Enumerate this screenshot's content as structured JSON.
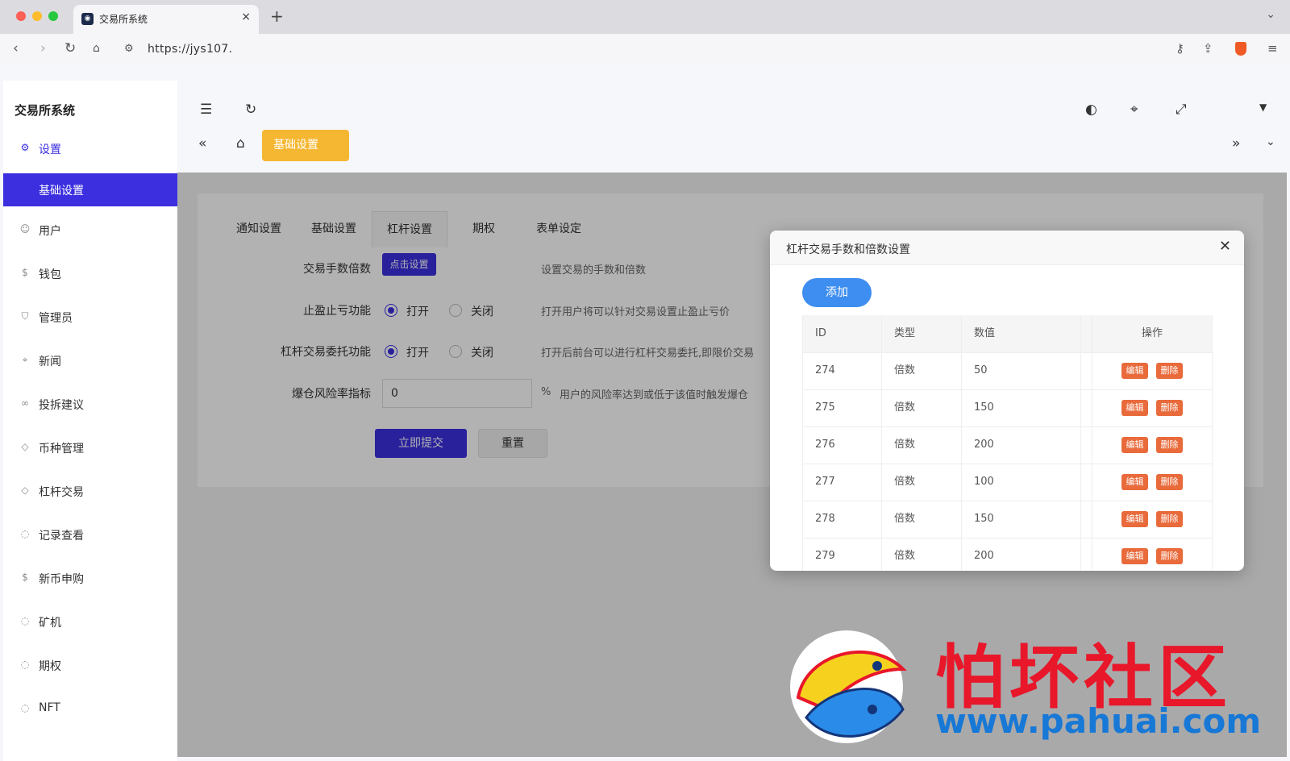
{
  "browser": {
    "tab_title": "交易所系统",
    "tab_close": "×",
    "new_tab": "+",
    "url": "https://jys107.",
    "icons": [
      "back-icon",
      "forward-icon",
      "reload-icon",
      "bookmark-icon",
      "site-settings-icon",
      "key-icon",
      "share-icon",
      "brave-shield-icon",
      "menu-icon"
    ]
  },
  "app": {
    "brand": "交易所系统",
    "page_tag": "基础设置"
  },
  "sidebar": {
    "items": [
      {
        "label": "设置",
        "icon": "gear-icon"
      },
      {
        "label": "基础设置",
        "icon": ""
      },
      {
        "label": "用户",
        "icon": "user-icon"
      },
      {
        "label": "钱包",
        "icon": "coin-icon"
      },
      {
        "label": "管理员",
        "icon": "shield-icon"
      },
      {
        "label": "新闻",
        "icon": "tag-icon"
      },
      {
        "label": "投拆建议",
        "icon": "link-icon"
      },
      {
        "label": "币种管理",
        "icon": "diamond-icon"
      },
      {
        "label": "杠杆交易",
        "icon": "diamond-icon"
      },
      {
        "label": "记录查看",
        "icon": "circle-icon"
      },
      {
        "label": "新币申购",
        "icon": "coin-icon"
      },
      {
        "label": "矿机",
        "icon": "circle-icon"
      },
      {
        "label": "期权",
        "icon": "circle-icon"
      },
      {
        "label": "NFT",
        "icon": "circle-icon"
      }
    ]
  },
  "tabs": [
    "通知设置",
    "基础设置",
    "杠杆设置",
    "期权",
    "表单设定"
  ],
  "form": {
    "fee_label": "交易手数倍数",
    "fee_button": "点击设置",
    "fee_hint": "设置交易的手数和倍数",
    "stop_label": "止盈止亏功能",
    "stop_hint": "打开用户将可以针对交易设置止盈止亏价",
    "entrust_label": "杠杆交易委托功能",
    "entrust_hint": "打开后前台可以进行杠杆交易委托,即限价交易",
    "open": "打开",
    "close": "关闭",
    "risk_label": "爆仓风险率指标",
    "risk_value": "0",
    "risk_unit": "%",
    "risk_hint": "用户的风险率达到或低于该值时触发爆仓",
    "submit": "立即提交",
    "reset": "重置"
  },
  "modal": {
    "title": "杠杆交易手数和倍数设置",
    "close": "✕",
    "add": "添加",
    "headers": {
      "id": "ID",
      "type": "类型",
      "value": "数值",
      "ops": "操作"
    },
    "edit": "编辑",
    "delete": "删除",
    "rows": [
      {
        "id": "274",
        "type": "倍数",
        "value": "50"
      },
      {
        "id": "275",
        "type": "倍数",
        "value": "150"
      },
      {
        "id": "276",
        "type": "倍数",
        "value": "200"
      },
      {
        "id": "277",
        "type": "倍数",
        "value": "100"
      },
      {
        "id": "278",
        "type": "倍数",
        "value": "150"
      },
      {
        "id": "279",
        "type": "倍数",
        "value": "200"
      }
    ]
  },
  "watermark": {
    "text": "怕坏社区",
    "url": "www.pahuai.com"
  },
  "colors": {
    "primary": "#3b2fe0",
    "tag": "#f5b731",
    "add": "#3d8ef0",
    "danger": "#e96a3b",
    "wm_red": "#e8172a",
    "wm_blue": "#1878d6"
  }
}
